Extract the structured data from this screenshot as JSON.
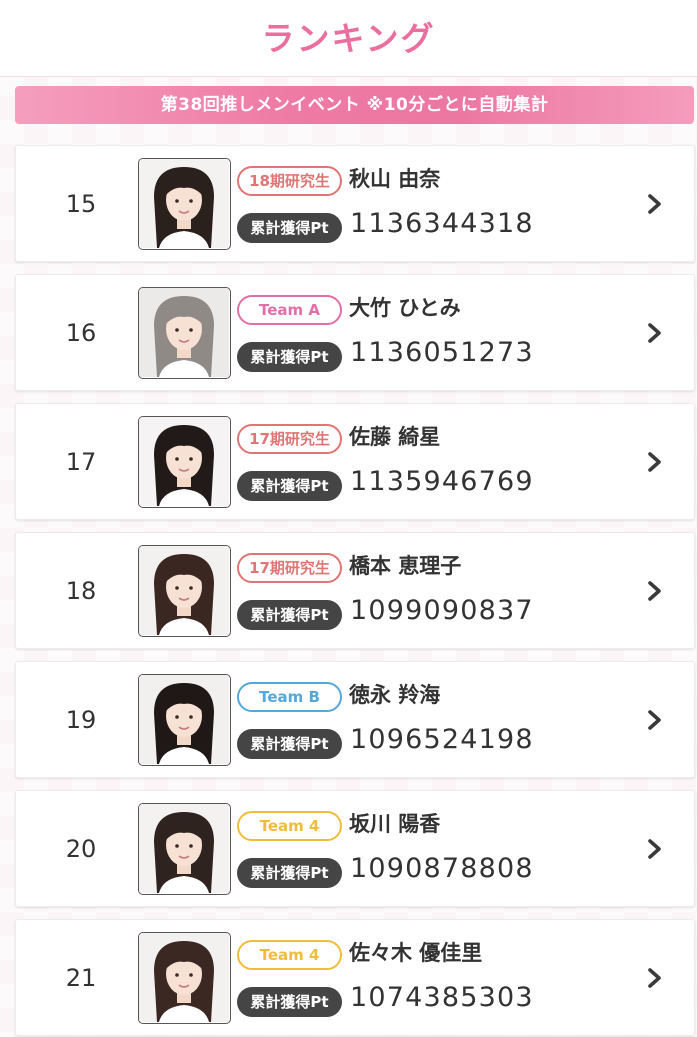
{
  "header": {
    "title": "ランキング"
  },
  "banner": {
    "text": "第38回推しメンイベント ※10分ごとに自動集計"
  },
  "colors": {
    "accent": "#ea6f9f",
    "kenkyusei": "#e07575",
    "team_a": "#e36fa9",
    "team_b": "#55a8da",
    "team_4": "#efbd3b",
    "pt_label_bg": "#454545"
  },
  "ranking": {
    "items": [
      {
        "rank": "15",
        "team": "18期研究生",
        "team_color": "#e07575",
        "name": "秋山 由奈",
        "pt_label": "累計獲得Pt",
        "points": "1136344318",
        "photo_icon": "member-photo",
        "arrow_icon": "chevron-right-icon",
        "hair": "#2a201c",
        "bg": "#f4f2f1"
      },
      {
        "rank": "16",
        "team": "Team A",
        "team_color": "#e36fa9",
        "name": "大竹 ひとみ",
        "pt_label": "累計獲得Pt",
        "points": "1136051273",
        "photo_icon": "member-photo",
        "arrow_icon": "chevron-right-icon",
        "hair": "#8f8a86",
        "bg": "#eceae8"
      },
      {
        "rank": "17",
        "team": "17期研究生",
        "team_color": "#e07575",
        "name": "佐藤 綺星",
        "pt_label": "累計獲得Pt",
        "points": "1135946769",
        "photo_icon": "member-photo",
        "arrow_icon": "chevron-right-icon",
        "hair": "#221a18",
        "bg": "#f5f3f3"
      },
      {
        "rank": "18",
        "team": "17期研究生",
        "team_color": "#e07575",
        "name": "橋本 恵理子",
        "pt_label": "累計獲得Pt",
        "points": "1099090837",
        "photo_icon": "member-photo",
        "arrow_icon": "chevron-right-icon",
        "hair": "#3a2722",
        "bg": "#f3f1f0"
      },
      {
        "rank": "19",
        "team": "Team B",
        "team_color": "#55a8da",
        "name": "徳永 羚海",
        "pt_label": "累計獲得Pt",
        "points": "1096524198",
        "photo_icon": "member-photo",
        "arrow_icon": "chevron-right-icon",
        "hair": "#1f1816",
        "bg": "#f2f0ef"
      },
      {
        "rank": "20",
        "team": "Team 4",
        "team_color": "#efbd3b",
        "name": "坂川 陽香",
        "pt_label": "累計獲得Pt",
        "points": "1090878808",
        "photo_icon": "member-photo",
        "arrow_icon": "chevron-right-icon",
        "hair": "#2f2320",
        "bg": "#f4f2f1"
      },
      {
        "rank": "21",
        "team": "Team 4",
        "team_color": "#efbd3b",
        "name": "佐々木 優佳里",
        "pt_label": "累計獲得Pt",
        "points": "1074385303",
        "photo_icon": "member-photo",
        "arrow_icon": "chevron-right-icon",
        "hair": "#3b2822",
        "bg": "#f3f1f0"
      }
    ]
  }
}
